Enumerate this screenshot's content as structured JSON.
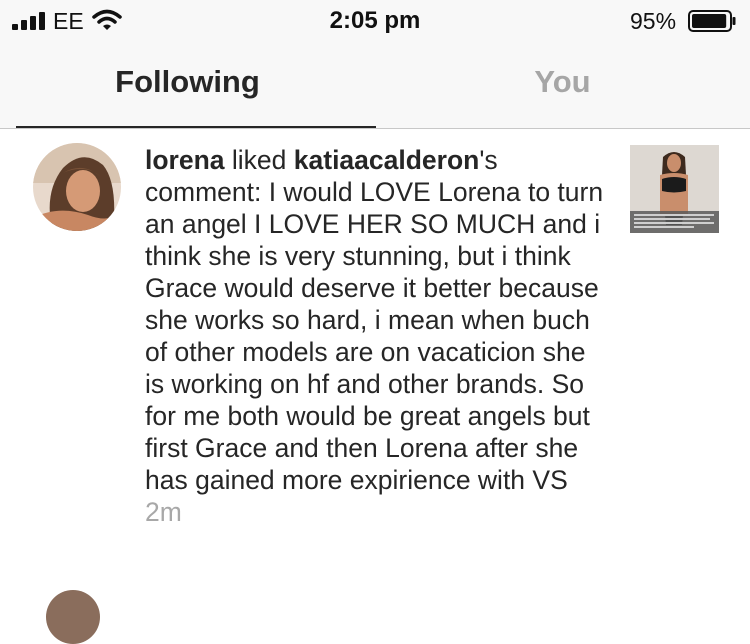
{
  "status_bar": {
    "carrier": "EE",
    "time": "2:05 pm",
    "battery_percent": "95%",
    "battery_level": 0.95,
    "signal_icon": "signal-bars-icon",
    "wifi_icon": "wifi-icon",
    "battery_icon": "battery-icon"
  },
  "tabs": [
    {
      "label": "Following",
      "active": true
    },
    {
      "label": "You",
      "active": false
    }
  ],
  "colors": {
    "active_tab": "#262626",
    "inactive_tab": "#a6a6a6",
    "timestamp": "#a8a8a8"
  },
  "activity": {
    "actor": "lorena",
    "action": " liked ",
    "target_user": "katiaacalderon",
    "suffix": "'s comment: ",
    "comment": "I would LOVE Lorena to turn an angel I LOVE HER SO MUCH and i think she is very stunning, but i think Grace would deserve it better because she works so hard, i mean when buch of other models are on vacaticion she is working on hf and other brands. So for me both would be great angels but first Grace and then Lorena after she has gained more expirience with VS",
    "time": "2m"
  }
}
